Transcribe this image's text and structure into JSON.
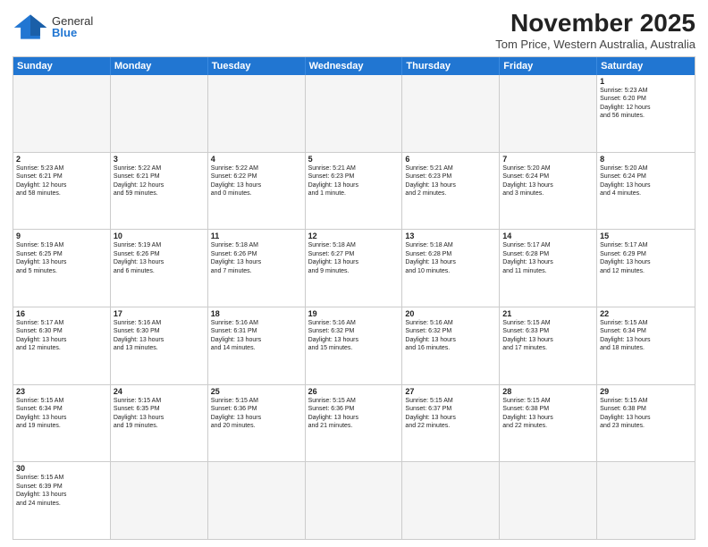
{
  "logo": {
    "general": "General",
    "blue": "Blue"
  },
  "title": "November 2025",
  "subtitle": "Tom Price, Western Australia, Australia",
  "days": [
    "Sunday",
    "Monday",
    "Tuesday",
    "Wednesday",
    "Thursday",
    "Friday",
    "Saturday"
  ],
  "weeks": [
    [
      {
        "day": "",
        "info": ""
      },
      {
        "day": "",
        "info": ""
      },
      {
        "day": "",
        "info": ""
      },
      {
        "day": "",
        "info": ""
      },
      {
        "day": "",
        "info": ""
      },
      {
        "day": "",
        "info": ""
      },
      {
        "day": "1",
        "info": "Sunrise: 5:23 AM\nSunset: 6:20 PM\nDaylight: 12 hours\nand 56 minutes."
      }
    ],
    [
      {
        "day": "2",
        "info": "Sunrise: 5:23 AM\nSunset: 6:21 PM\nDaylight: 12 hours\nand 58 minutes."
      },
      {
        "day": "3",
        "info": "Sunrise: 5:22 AM\nSunset: 6:21 PM\nDaylight: 12 hours\nand 59 minutes."
      },
      {
        "day": "4",
        "info": "Sunrise: 5:22 AM\nSunset: 6:22 PM\nDaylight: 13 hours\nand 0 minutes."
      },
      {
        "day": "5",
        "info": "Sunrise: 5:21 AM\nSunset: 6:23 PM\nDaylight: 13 hours\nand 1 minute."
      },
      {
        "day": "6",
        "info": "Sunrise: 5:21 AM\nSunset: 6:23 PM\nDaylight: 13 hours\nand 2 minutes."
      },
      {
        "day": "7",
        "info": "Sunrise: 5:20 AM\nSunset: 6:24 PM\nDaylight: 13 hours\nand 3 minutes."
      },
      {
        "day": "8",
        "info": "Sunrise: 5:20 AM\nSunset: 6:24 PM\nDaylight: 13 hours\nand 4 minutes."
      }
    ],
    [
      {
        "day": "9",
        "info": "Sunrise: 5:19 AM\nSunset: 6:25 PM\nDaylight: 13 hours\nand 5 minutes."
      },
      {
        "day": "10",
        "info": "Sunrise: 5:19 AM\nSunset: 6:26 PM\nDaylight: 13 hours\nand 6 minutes."
      },
      {
        "day": "11",
        "info": "Sunrise: 5:18 AM\nSunset: 6:26 PM\nDaylight: 13 hours\nand 7 minutes."
      },
      {
        "day": "12",
        "info": "Sunrise: 5:18 AM\nSunset: 6:27 PM\nDaylight: 13 hours\nand 9 minutes."
      },
      {
        "day": "13",
        "info": "Sunrise: 5:18 AM\nSunset: 6:28 PM\nDaylight: 13 hours\nand 10 minutes."
      },
      {
        "day": "14",
        "info": "Sunrise: 5:17 AM\nSunset: 6:28 PM\nDaylight: 13 hours\nand 11 minutes."
      },
      {
        "day": "15",
        "info": "Sunrise: 5:17 AM\nSunset: 6:29 PM\nDaylight: 13 hours\nand 12 minutes."
      }
    ],
    [
      {
        "day": "16",
        "info": "Sunrise: 5:17 AM\nSunset: 6:30 PM\nDaylight: 13 hours\nand 12 minutes."
      },
      {
        "day": "17",
        "info": "Sunrise: 5:16 AM\nSunset: 6:30 PM\nDaylight: 13 hours\nand 13 minutes."
      },
      {
        "day": "18",
        "info": "Sunrise: 5:16 AM\nSunset: 6:31 PM\nDaylight: 13 hours\nand 14 minutes."
      },
      {
        "day": "19",
        "info": "Sunrise: 5:16 AM\nSunset: 6:32 PM\nDaylight: 13 hours\nand 15 minutes."
      },
      {
        "day": "20",
        "info": "Sunrise: 5:16 AM\nSunset: 6:32 PM\nDaylight: 13 hours\nand 16 minutes."
      },
      {
        "day": "21",
        "info": "Sunrise: 5:15 AM\nSunset: 6:33 PM\nDaylight: 13 hours\nand 17 minutes."
      },
      {
        "day": "22",
        "info": "Sunrise: 5:15 AM\nSunset: 6:34 PM\nDaylight: 13 hours\nand 18 minutes."
      }
    ],
    [
      {
        "day": "23",
        "info": "Sunrise: 5:15 AM\nSunset: 6:34 PM\nDaylight: 13 hours\nand 19 minutes."
      },
      {
        "day": "24",
        "info": "Sunrise: 5:15 AM\nSunset: 6:35 PM\nDaylight: 13 hours\nand 19 minutes."
      },
      {
        "day": "25",
        "info": "Sunrise: 5:15 AM\nSunset: 6:36 PM\nDaylight: 13 hours\nand 20 minutes."
      },
      {
        "day": "26",
        "info": "Sunrise: 5:15 AM\nSunset: 6:36 PM\nDaylight: 13 hours\nand 21 minutes."
      },
      {
        "day": "27",
        "info": "Sunrise: 5:15 AM\nSunset: 6:37 PM\nDaylight: 13 hours\nand 22 minutes."
      },
      {
        "day": "28",
        "info": "Sunrise: 5:15 AM\nSunset: 6:38 PM\nDaylight: 13 hours\nand 22 minutes."
      },
      {
        "day": "29",
        "info": "Sunrise: 5:15 AM\nSunset: 6:38 PM\nDaylight: 13 hours\nand 23 minutes."
      }
    ],
    [
      {
        "day": "30",
        "info": "Sunrise: 5:15 AM\nSunset: 6:39 PM\nDaylight: 13 hours\nand 24 minutes."
      },
      {
        "day": "",
        "info": ""
      },
      {
        "day": "",
        "info": ""
      },
      {
        "day": "",
        "info": ""
      },
      {
        "day": "",
        "info": ""
      },
      {
        "day": "",
        "info": ""
      },
      {
        "day": "",
        "info": ""
      }
    ]
  ]
}
